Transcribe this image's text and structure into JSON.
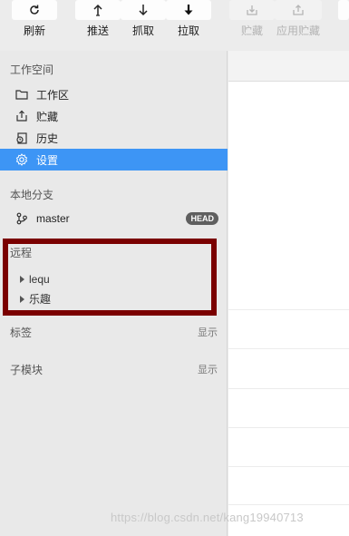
{
  "toolbar": {
    "refresh": "刷新",
    "push": "推送",
    "fetch": "抓取",
    "pull": "拉取",
    "stash": "贮藏",
    "apply_stash": "应用贮藏"
  },
  "sidebar": {
    "workspace_title": "工作空间",
    "workspace_items": [
      "工作区",
      "贮藏",
      "历史",
      "设置"
    ],
    "branches_title": "本地分支",
    "branch": {
      "name": "master",
      "badge": "HEAD"
    },
    "remotes_title": "远程",
    "remotes": [
      "lequ",
      "乐趣"
    ],
    "tags_title": "标签",
    "tags_action": "显示",
    "submodules_title": "子模块",
    "submodules_action": "显示"
  },
  "watermark": "https://blog.csdn.net/kang19940713",
  "colors": {
    "selected": "#3d95f5",
    "highlight": "#7a0000",
    "badge": "#5f5f5f"
  }
}
